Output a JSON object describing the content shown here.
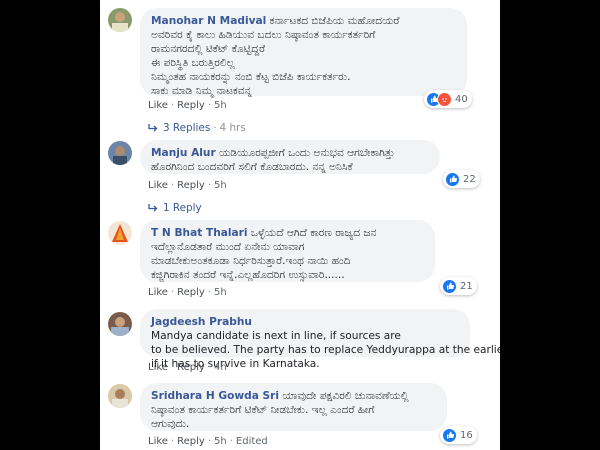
{
  "comments": [
    {
      "author": "Manohar N Madival",
      "lines": [
        "ಕರ್ನಾಟಕದ ಬಿಜೆಪಿಯ ಮಹೋದಯರೆ",
        "ಅವರಿವರ ಕೈ ಕಾಲು ಹಿಡಿಯುವ ಬದಲು ನಿಷ್ಠಾವಂತ ಕಾರ್ಯಕರ್ತರಿಗೆ",
        "ರಾಮನಗರದಲ್ಲಿ ಟಿಕೆಟ್ ಕೊಟ್ಟಿದ್ದರೆ",
        "ಈ ಪರಿಸ್ಥಿತಿ ಬರುತ್ತಿರಲಿಲ್ಲ",
        "ನಿಮ್ಮಂತಹ ನಾಯಕರನ್ನು ನಂಬಿ ಕೆಟ್ಟ ಬಿಜೆಪಿ ಕಾರ್ಯಕರ್ತರು.",
        "ಸಾಕು ಮಾಡಿ ನಿಮ್ಮ ನಾಟಕವನ್ನ"
      ],
      "like": "Like",
      "reply": "Reply",
      "time": "5h",
      "edited": "",
      "reactions": "40",
      "reaction_types": [
        "like-icon",
        "angry-icon"
      ],
      "replies_text": "3 Replies",
      "replies_time": "4 hrs"
    },
    {
      "author": "Manju Alur",
      "lines": [
        "ಯಡಿಯೂರಪ್ಪಜೀಗೆ ಒಂದು ಅನುಭವ ಆಗಬೇಕಾಗಿತ್ತು",
        "ಹೊರಗಿನಿಂದ ಬಂದವರಿಗೆ ಸಲಿಗೆ ಕೊಡಬಾರದು. ನನ್ನ ಅನಿಸಿಕೆ"
      ],
      "like": "Like",
      "reply": "Reply",
      "time": "5h",
      "edited": "",
      "reactions": "22",
      "reaction_types": [
        "like-icon"
      ],
      "replies_text": "1 Reply",
      "replies_time": ""
    },
    {
      "author": "T N Bhat Thalari",
      "lines": [
        "ಒಳ್ಳೆಯದೆ ಆಗಿದೆ ಕಾರಣ ರಾಜ್ಯದ ಜನ",
        "ಇದೆಲ್ಲಾನೊಡತಾರೆ ಮುಂದೆ ಏನೇನು ಯಾವಾಗ",
        "ಮಾಡಬೇಕುಅಂತಕೂಡಾ ನಿರ್ಧರಿಸುತ್ತಾರೆ.ಇಂಥ ನಾಯಿ ಹಂದಿ",
        "ಕಜ್ಜಿಗಿರಾಕಿನ ತಂದರೆ ಇನ್ನೆ.ಎಲ್ಲಹೊದರಿಗ ಉಸ್ಸುವಾರಿ......"
      ],
      "like": "Like",
      "reply": "Reply",
      "time": "5h",
      "edited": "",
      "reactions": "21",
      "reaction_types": [
        "like-icon"
      ],
      "replies_text": "",
      "replies_time": ""
    },
    {
      "author": "Jagdeesh Prabhu",
      "lines": [
        "Mandya candidate is next in line, if sources are",
        "to be believed. The party has to replace Yeddyurappa at the earliest,",
        "if it has to survive in Karnataka."
      ],
      "like": "Like",
      "reply": "Reply",
      "time": "4h",
      "edited": "",
      "reactions": "",
      "reaction_types": [],
      "replies_text": "",
      "replies_time": ""
    },
    {
      "author": "Sridhara H Gowda Sri",
      "lines": [
        "ಯಾವುದೇ ಪಕ್ಷವಿರಲಿ ಚುನಾವಣೆಯಲ್ಲಿ",
        "ನಿಷ್ಠಾವಂತ ಕಾರ್ಯಕರ್ತರಿಗೆ ಟಿಕೆಟ್ ನೀಡಬೇಕು. ಇಲ್ಲ ಎಂದರೆ ಹೀಗೆ",
        "ಆಗುವುದು."
      ],
      "like": "Like",
      "reply": "Reply",
      "time": "5h",
      "edited": "Edited",
      "reactions": "16",
      "reaction_types": [
        "like-icon"
      ],
      "replies_text": "",
      "replies_time": ""
    }
  ],
  "colors": {
    "author": "#385898",
    "bubble": "#f2f3f5",
    "like": "#1877f2",
    "angry": "#f5533d"
  }
}
